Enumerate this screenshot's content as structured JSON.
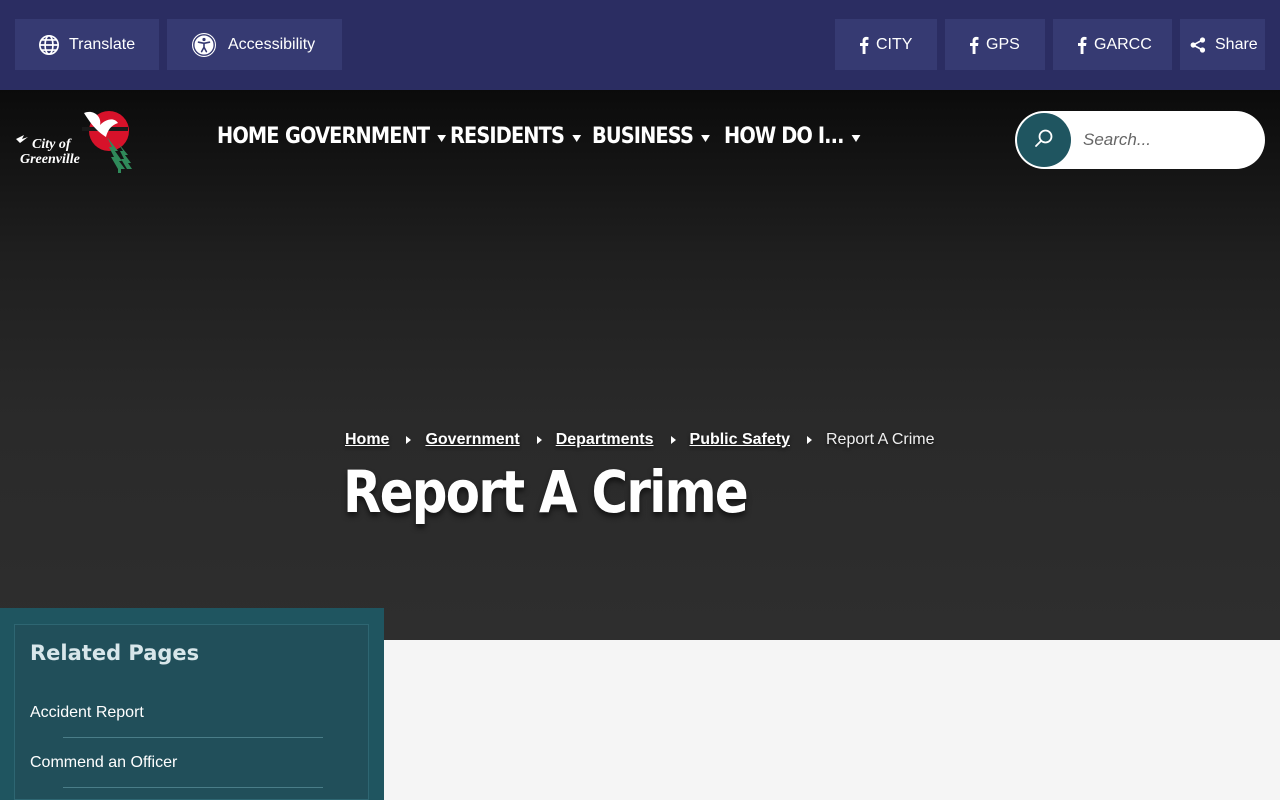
{
  "topbar": {
    "translate_label": "Translate",
    "accessibility_label": "Accessibility",
    "social": [
      {
        "label": "CITY",
        "icon": "facebook-icon"
      },
      {
        "label": "GPS",
        "icon": "facebook-icon"
      },
      {
        "label": "GARCC",
        "icon": "facebook-icon"
      }
    ],
    "share_label": "Share"
  },
  "logo": {
    "line1": "City of",
    "line2": "Greenville"
  },
  "nav": {
    "items": [
      {
        "label": "HOME"
      },
      {
        "label": "GOVERNMENT"
      },
      {
        "label": "RESIDENTS"
      },
      {
        "label": "BUSINESS"
      },
      {
        "label": "HOW DO I..."
      }
    ]
  },
  "search": {
    "placeholder": "Search..."
  },
  "breadcrumb": {
    "items": [
      "Home",
      "Government",
      "Departments",
      "Public Safety"
    ],
    "current": "Report A Crime"
  },
  "page": {
    "title": "Report A Crime"
  },
  "related": {
    "title": "Related Pages",
    "items": [
      "Accident Report",
      "Commend an Officer"
    ]
  },
  "colors": {
    "topbar_bg": "#2b2d62",
    "topbar_button": "#363a72",
    "teal": "#1f5560",
    "logo_red": "#d7122a",
    "logo_green": "#2f8a5a"
  }
}
